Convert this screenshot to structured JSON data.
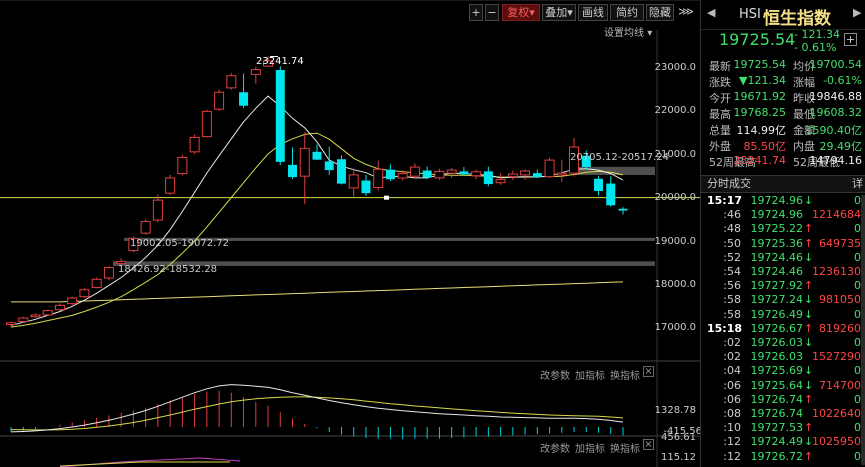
{
  "toolbar": {
    "plus": "+",
    "minus": "−",
    "fuquan": "复权",
    "diejia": "叠加",
    "huaxian": "画线",
    "jianyue": "简约",
    "yincang": "隐藏",
    "settings": "设置均线"
  },
  "annotations": {
    "high_label": "23241.74",
    "gap1": "20705.12-20517.24",
    "gap2": "19002.05-19072.72",
    "gap3": "18426.92-18532.28"
  },
  "yaxis": [
    "23000.0",
    "22000.0",
    "21000.0",
    "20000.0",
    "19000.0",
    "18000.0",
    "17000.0"
  ],
  "macd_panel": {
    "controls": [
      "改参数",
      "加指标",
      "换指标"
    ],
    "yaxis": [
      "1328.78",
      "456.61",
      "-415.56"
    ]
  },
  "bottom_panel": {
    "controls": [
      "改参数",
      "加指标",
      "换指标"
    ],
    "yaxis": [
      "115.12"
    ]
  },
  "chart_data": {
    "type": "candlestick",
    "ylim": [
      16800,
      23600
    ],
    "reference_line": 19996,
    "candles": [
      {
        "o": 17080,
        "h": 17150,
        "l": 17020,
        "c": 17120
      },
      {
        "o": 17150,
        "h": 17260,
        "l": 17120,
        "c": 17230
      },
      {
        "o": 17260,
        "h": 17330,
        "l": 17230,
        "c": 17300
      },
      {
        "o": 17300,
        "h": 17420,
        "l": 17270,
        "c": 17400
      },
      {
        "o": 17420,
        "h": 17560,
        "l": 17390,
        "c": 17520
      },
      {
        "o": 17560,
        "h": 17720,
        "l": 17530,
        "c": 17690
      },
      {
        "o": 17720,
        "h": 17920,
        "l": 17690,
        "c": 17880
      },
      {
        "o": 17930,
        "h": 18160,
        "l": 17910,
        "c": 18120
      },
      {
        "o": 18150,
        "h": 18420,
        "l": 18100,
        "c": 18390
      },
      {
        "o": 18480,
        "h": 18600,
        "l": 18430,
        "c": 18530
      },
      {
        "o": 18780,
        "h": 19100,
        "l": 18740,
        "c": 19060
      },
      {
        "o": 19180,
        "h": 19500,
        "l": 19150,
        "c": 19450
      },
      {
        "o": 19480,
        "h": 20070,
        "l": 19430,
        "c": 19940
      },
      {
        "o": 20100,
        "h": 20520,
        "l": 20060,
        "c": 20450
      },
      {
        "o": 20550,
        "h": 20980,
        "l": 20510,
        "c": 20920
      },
      {
        "o": 21050,
        "h": 21450,
        "l": 21000,
        "c": 21380
      },
      {
        "o": 21400,
        "h": 22020,
        "l": 21380,
        "c": 21980
      },
      {
        "o": 22030,
        "h": 22480,
        "l": 21990,
        "c": 22420
      },
      {
        "o": 22520,
        "h": 22860,
        "l": 22480,
        "c": 22800
      },
      {
        "o": 22420,
        "h": 22850,
        "l": 22060,
        "c": 22110
      },
      {
        "o": 22830,
        "h": 23000,
        "l": 22620,
        "c": 22940
      },
      {
        "o": 23020,
        "h": 23241,
        "l": 23000,
        "c": 23140
      },
      {
        "o": 22930,
        "h": 23020,
        "l": 20750,
        "c": 20820
      },
      {
        "o": 20750,
        "h": 21150,
        "l": 20420,
        "c": 20470
      },
      {
        "o": 20490,
        "h": 21500,
        "l": 19850,
        "c": 21130
      },
      {
        "o": 21050,
        "h": 21220,
        "l": 20860,
        "c": 20870
      },
      {
        "o": 20830,
        "h": 21170,
        "l": 20520,
        "c": 20630
      },
      {
        "o": 20880,
        "h": 20970,
        "l": 20300,
        "c": 20320
      },
      {
        "o": 20220,
        "h": 20670,
        "l": 20020,
        "c": 20520
      },
      {
        "o": 20390,
        "h": 20520,
        "l": 20040,
        "c": 20100
      },
      {
        "o": 20230,
        "h": 20850,
        "l": 20160,
        "c": 20650
      },
      {
        "o": 20640,
        "h": 20760,
        "l": 20380,
        "c": 20420
      },
      {
        "o": 20450,
        "h": 20630,
        "l": 20390,
        "c": 20550
      },
      {
        "o": 20490,
        "h": 20780,
        "l": 20430,
        "c": 20700
      },
      {
        "o": 20620,
        "h": 20710,
        "l": 20420,
        "c": 20460
      },
      {
        "o": 20450,
        "h": 20660,
        "l": 20410,
        "c": 20600
      },
      {
        "o": 20560,
        "h": 20680,
        "l": 20450,
        "c": 20630
      },
      {
        "o": 20600,
        "h": 20700,
        "l": 20520,
        "c": 20530
      },
      {
        "o": 20500,
        "h": 20640,
        "l": 20420,
        "c": 20590
      },
      {
        "o": 20600,
        "h": 20710,
        "l": 20260,
        "c": 20310
      },
      {
        "o": 20340,
        "h": 20560,
        "l": 20290,
        "c": 20410
      },
      {
        "o": 20480,
        "h": 20620,
        "l": 20400,
        "c": 20540
      },
      {
        "o": 20520,
        "h": 20650,
        "l": 20410,
        "c": 20610
      },
      {
        "o": 20560,
        "h": 20640,
        "l": 20450,
        "c": 20470
      },
      {
        "o": 20480,
        "h": 20920,
        "l": 20450,
        "c": 20860
      },
      {
        "o": 20520,
        "h": 20870,
        "l": 20360,
        "c": 20560
      },
      {
        "o": 20560,
        "h": 21370,
        "l": 20480,
        "c": 21160
      },
      {
        "o": 20960,
        "h": 21080,
        "l": 20650,
        "c": 20700
      },
      {
        "o": 20430,
        "h": 20500,
        "l": 20050,
        "c": 20150
      },
      {
        "o": 20320,
        "h": 20490,
        "l": 19790,
        "c": 19820
      },
      {
        "o": 19740,
        "h": 19780,
        "l": 19610,
        "c": 19700
      }
    ],
    "ma5": [
      17060,
      17130,
      17200,
      17290,
      17380,
      17500,
      17640,
      17800,
      17980,
      18160,
      18380,
      18620,
      18900,
      19260,
      19680,
      20120,
      20560,
      20960,
      21350,
      21740,
      22050,
      22330,
      22100,
      21820,
      21600,
      21280,
      20860,
      20720,
      20640,
      20570,
      20450,
      20480,
      20490,
      20450,
      20450,
      20520,
      20560,
      20550,
      20530,
      20510,
      20450,
      20470,
      20480,
      20470,
      20500,
      20570,
      20650,
      20660,
      20630,
      20550,
      20400
    ],
    "ma10": [
      17020,
      17060,
      17110,
      17170,
      17230,
      17290,
      17380,
      17480,
      17590,
      17720,
      17880,
      18050,
      18230,
      18460,
      18720,
      19000,
      19320,
      19660,
      20000,
      20340,
      20680,
      21000,
      21220,
      21350,
      21450,
      21480,
      21340,
      21120,
      20900,
      20760,
      20660,
      20620,
      20590,
      20570,
      20540,
      20520,
      20510,
      20510,
      20500,
      20490,
      20470,
      20470,
      20470,
      20480,
      20480,
      20490,
      20530,
      20580,
      20600,
      20580,
      20520
    ],
    "ma250": [
      17600,
      17600,
      17600,
      17600,
      17600,
      17610,
      17620,
      17630,
      17640,
      17650,
      17660,
      17670,
      17680,
      17690,
      17700,
      17710,
      17720,
      17730,
      17740,
      17750,
      17760,
      17770,
      17780,
      17790,
      17800,
      17810,
      17820,
      17830,
      17840,
      17850,
      17860,
      17870,
      17880,
      17890,
      17900,
      17910,
      17920,
      17930,
      17940,
      17950,
      17960,
      17970,
      17980,
      17990,
      18000,
      18010,
      18020,
      18030,
      18040,
      18050,
      18060
    ],
    "macd_dif": [
      -150,
      -140,
      -120,
      -90,
      -50,
      0,
      60,
      130,
      210,
      300,
      400,
      510,
      640,
      780,
      920,
      1060,
      1180,
      1270,
      1310,
      1290,
      1260,
      1230,
      1150,
      1060,
      980,
      900,
      820,
      750,
      690,
      630,
      580,
      540,
      500,
      470,
      440,
      410,
      390,
      370,
      350,
      330,
      310,
      300,
      290,
      280,
      270,
      270,
      270,
      260,
      240,
      200,
      150
    ],
    "macd_dea": [
      -80,
      -85,
      -90,
      -90,
      -85,
      -70,
      -45,
      -10,
      30,
      80,
      140,
      210,
      290,
      370,
      460,
      550,
      630,
      710,
      780,
      830,
      870,
      900,
      920,
      930,
      930,
      920,
      900,
      870,
      840,
      800,
      760,
      720,
      690,
      650,
      620,
      590,
      560,
      530,
      500,
      480,
      450,
      430,
      410,
      390,
      370,
      360,
      350,
      340,
      330,
      310,
      280
    ],
    "macd_hist": [
      -140,
      -110,
      -60,
      0,
      70,
      140,
      210,
      280,
      360,
      440,
      520,
      600,
      700,
      820,
      920,
      1020,
      1100,
      1120,
      1060,
      920,
      780,
      660,
      460,
      260,
      100,
      -40,
      -160,
      -240,
      -300,
      -340,
      -360,
      -360,
      -380,
      -360,
      -360,
      -360,
      -340,
      -320,
      -300,
      -300,
      -280,
      -260,
      -240,
      -220,
      -200,
      -180,
      -160,
      -160,
      -180,
      -220,
      -260
    ]
  },
  "quote": {
    "code": "HSI",
    "name": "恒生指数",
    "price": "19725.54",
    "change": "- 121.34",
    "change_pct": "- 0.61%",
    "plus_btn": "+",
    "rows": [
      {
        "k1": "最新",
        "v1": "19725.54",
        "c1": "green",
        "k2": "均价",
        "v2": "19700.54",
        "c2": "green"
      },
      {
        "k1": "涨跌",
        "v1": "▼121.34",
        "c1": "green",
        "k2": "涨幅",
        "v2": "-0.61%",
        "c2": "green"
      },
      {
        "k1": "今开",
        "v1": "19671.92",
        "c1": "green",
        "k2": "昨收",
        "v2": "19846.88",
        "c2": "white"
      },
      {
        "k1": "最高",
        "v1": "19768.25",
        "c1": "green",
        "k2": "最低",
        "v2": "19608.32",
        "c2": "green"
      },
      {
        "k1": "总量",
        "v1": "114.99亿",
        "c1": "white",
        "k2": "金额",
        "v2": "1590.40亿",
        "c2": "green"
      },
      {
        "k1": "外盘",
        "v1": "85.50亿",
        "c1": "red2",
        "k2": "内盘",
        "v2": "29.49亿",
        "c2": "green"
      },
      {
        "k1": "52周最高",
        "v1": "23241.74",
        "c1": "red2",
        "k2": "52周最低",
        "v2": "14794.16",
        "c2": "white"
      }
    ]
  },
  "ticks": {
    "title": "分时成交",
    "detail": "详",
    "rows": [
      {
        "t": "15:17",
        "p": "19724.96",
        "a": "↓",
        "v": "0",
        "vc": "green"
      },
      {
        "t": ":46",
        "p": "19724.96",
        "a": "",
        "v": "1214684",
        "vc": "red2"
      },
      {
        "t": ":48",
        "p": "19725.22",
        "a": "↑",
        "v": "0",
        "vc": "green"
      },
      {
        "t": ":50",
        "p": "19725.36",
        "a": "↑",
        "v": "649735",
        "vc": "red2"
      },
      {
        "t": ":52",
        "p": "19724.46",
        "a": "↓",
        "v": "0",
        "vc": "green"
      },
      {
        "t": ":54",
        "p": "19724.46",
        "a": "",
        "v": "1236130",
        "vc": "red2"
      },
      {
        "t": ":56",
        "p": "19727.92",
        "a": "↑",
        "v": "0",
        "vc": "green"
      },
      {
        "t": ":58",
        "p": "19727.24",
        "a": "↓",
        "v": "981050",
        "vc": "red2"
      },
      {
        "t": ":58",
        "p": "19726.49",
        "a": "↓",
        "v": "0",
        "vc": "green"
      },
      {
        "t": "15:18",
        "p": "19726.67",
        "a": "↑",
        "v": "819260",
        "vc": "red2"
      },
      {
        "t": ":02",
        "p": "19726.03",
        "a": "↓",
        "v": "0",
        "vc": "green"
      },
      {
        "t": ":02",
        "p": "19726.03",
        "a": "",
        "v": "1527290",
        "vc": "red2"
      },
      {
        "t": ":04",
        "p": "19725.69",
        "a": "↓",
        "v": "0",
        "vc": "green"
      },
      {
        "t": ":06",
        "p": "19725.64",
        "a": "↓",
        "v": "714700",
        "vc": "red2"
      },
      {
        "t": ":06",
        "p": "19726.74",
        "a": "↑",
        "v": "0",
        "vc": "green"
      },
      {
        "t": ":08",
        "p": "19726.74",
        "a": "",
        "v": "1022640",
        "vc": "red2"
      },
      {
        "t": ":10",
        "p": "19727.53",
        "a": "↑",
        "v": "0",
        "vc": "green"
      },
      {
        "t": ":12",
        "p": "19724.49",
        "a": "↓",
        "v": "1025950",
        "vc": "red2"
      },
      {
        "t": ":12",
        "p": "19726.72",
        "a": "↑",
        "v": "0",
        "vc": "green"
      }
    ]
  }
}
